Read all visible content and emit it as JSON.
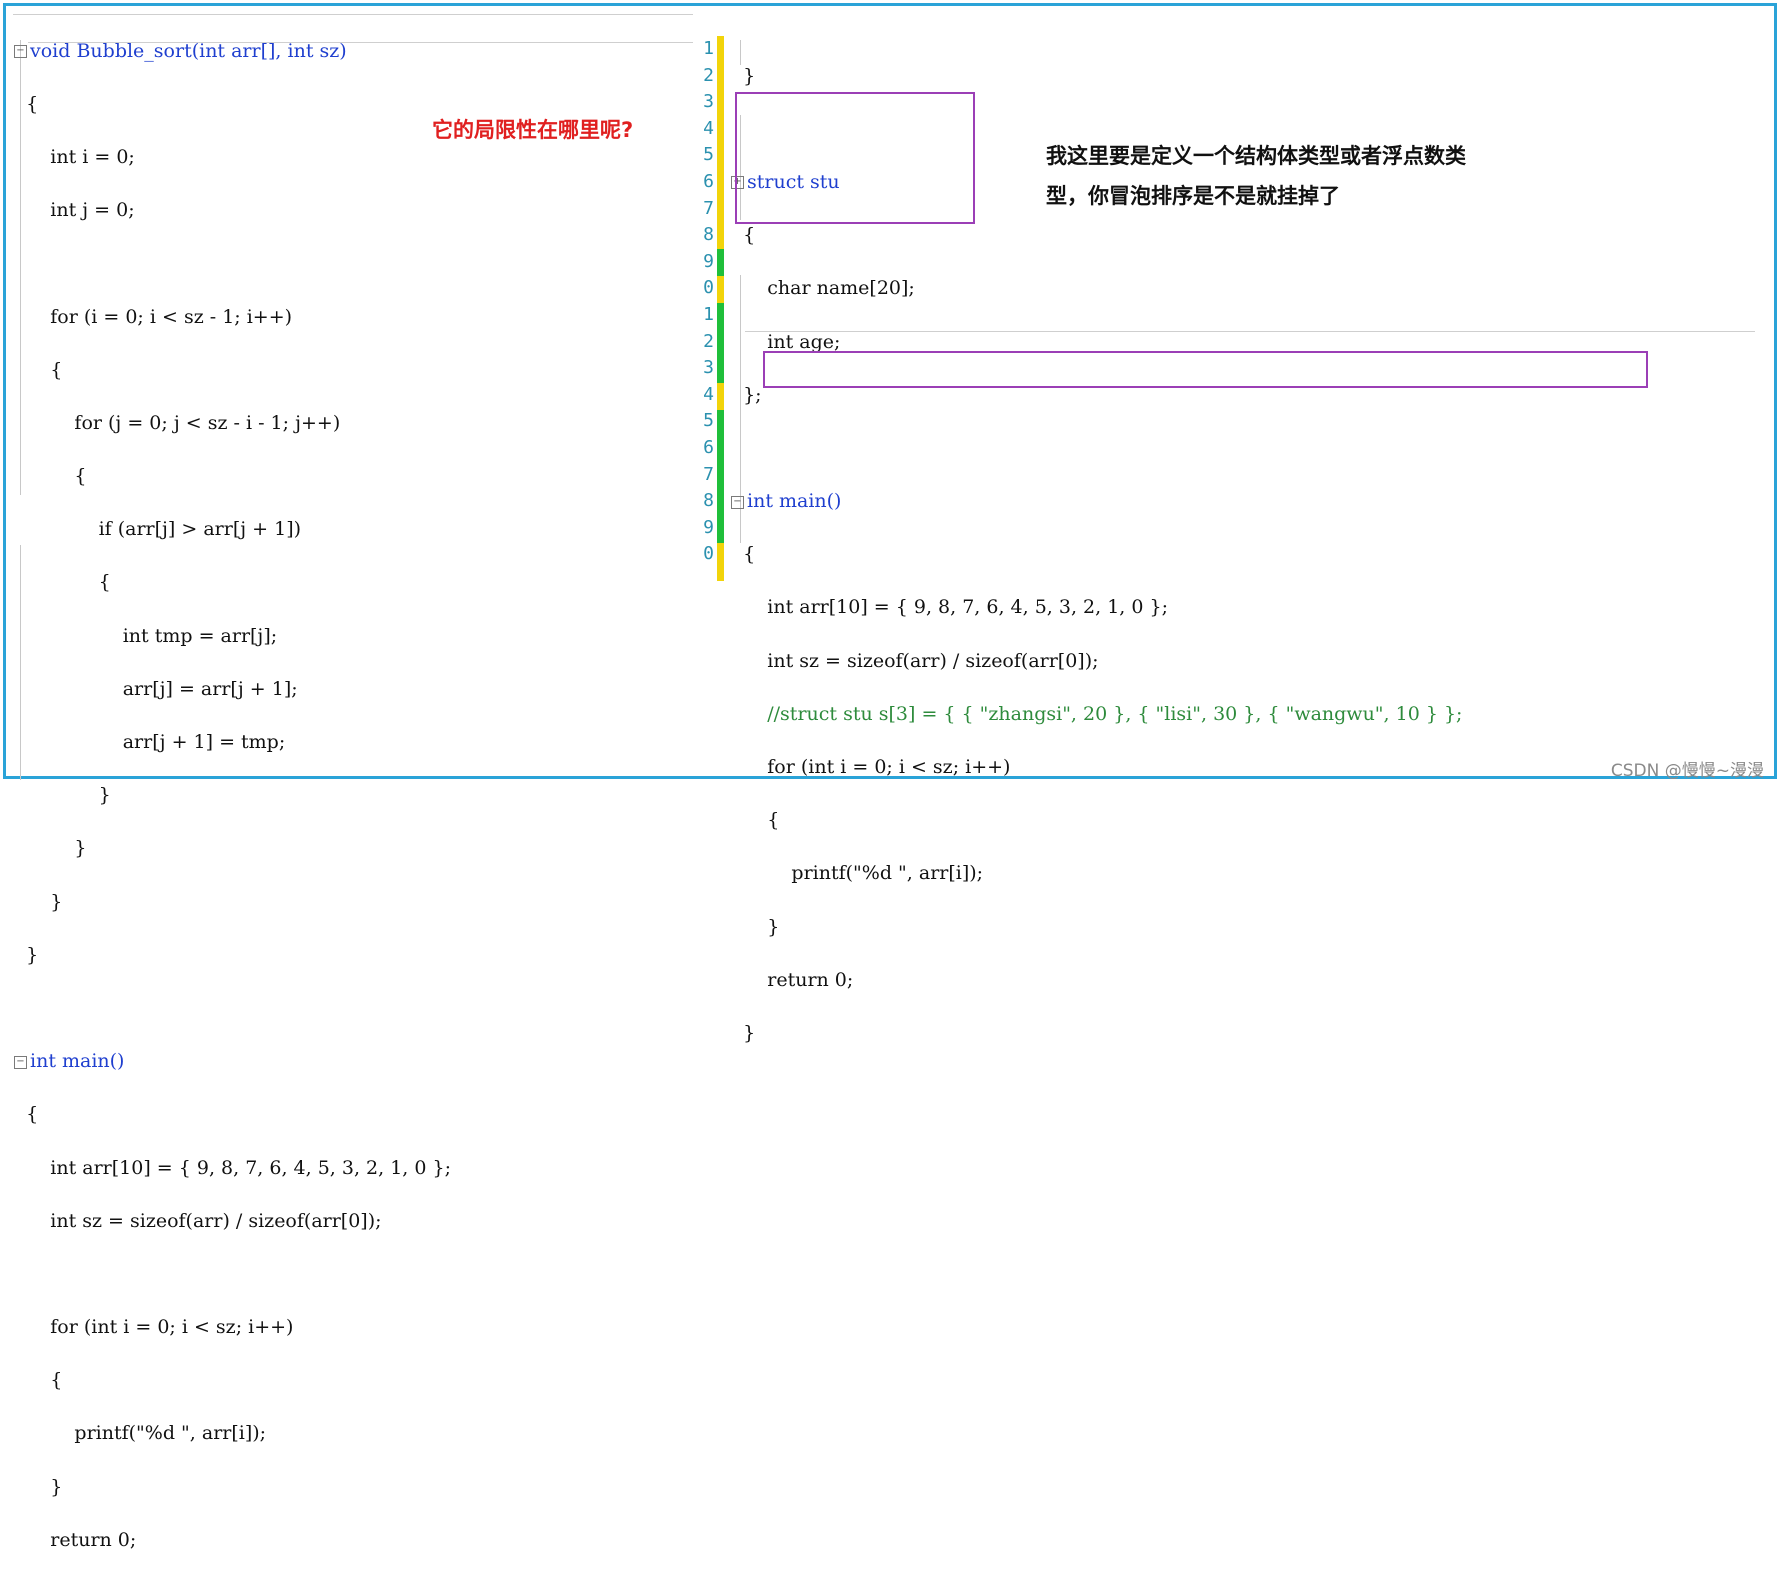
{
  "left_code": [
    "void Bubble_sort(int arr[], int sz)",
    "{",
    "    int i = 0;",
    "    int j = 0;",
    "",
    "    for (i = 0; i < sz - 1; i++)",
    "    {",
    "        for (j = 0; j < sz - i - 1; j++)",
    "        {",
    "            if (arr[j] > arr[j + 1])",
    "            {",
    "                int tmp = arr[j];",
    "                arr[j] = arr[j + 1];",
    "                arr[j + 1] = tmp;",
    "            }",
    "        }",
    "    }",
    "}",
    "",
    "int main()",
    "{",
    "    int arr[10] = { 9, 8, 7, 6, 4, 5, 3, 2, 1, 0 };",
    "    int sz = sizeof(arr) / sizeof(arr[0]);",
    "",
    "    for (int i = 0; i < sz; i++)",
    "    {",
    "        printf(\"%d \", arr[i]);",
    "    }",
    "    return 0;"
  ],
  "right_line_numbers": [
    "1",
    "2",
    "3",
    "4",
    "5",
    "6",
    "7",
    "8",
    "9",
    "0",
    "1",
    "2",
    "3",
    "4",
    "5",
    "6",
    "7",
    "8",
    "9",
    "0"
  ],
  "right_code": [
    "}",
    "",
    "struct stu",
    "{",
    "    char name[20];",
    "    int age;",
    "};",
    "",
    "int main()",
    "{",
    "    int arr[10] = { 9, 8, 7, 6, 4, 5, 3, 2, 1, 0 };",
    "    int sz = sizeof(arr) / sizeof(arr[0]);",
    "    //struct stu s[3] = { { \"zhangsi\", 20 }, { \"lisi\", 30 }, { \"wangwu\", 10 } };",
    "    for (int i = 0; i < sz; i++)",
    "    {",
    "        printf(\"%d \", arr[i]);",
    "    }",
    "    return 0;",
    "}",
    ""
  ],
  "annotations": {
    "question": "它的局限性在哪里呢?",
    "comment_line1": "我这里要是定义一个结构体类型或者浮点数类",
    "comment_line2": "型，你冒泡排序是不是就挂掉了"
  },
  "watermark": "CSDN @慢慢~漫漫",
  "colors": {
    "frame": "#2aa3d8",
    "highlight_box": "#9b3fb6",
    "annotation_red": "#e02020",
    "change_bar_yellow": "#f2d40a",
    "change_bar_green": "#1fbf3a"
  }
}
